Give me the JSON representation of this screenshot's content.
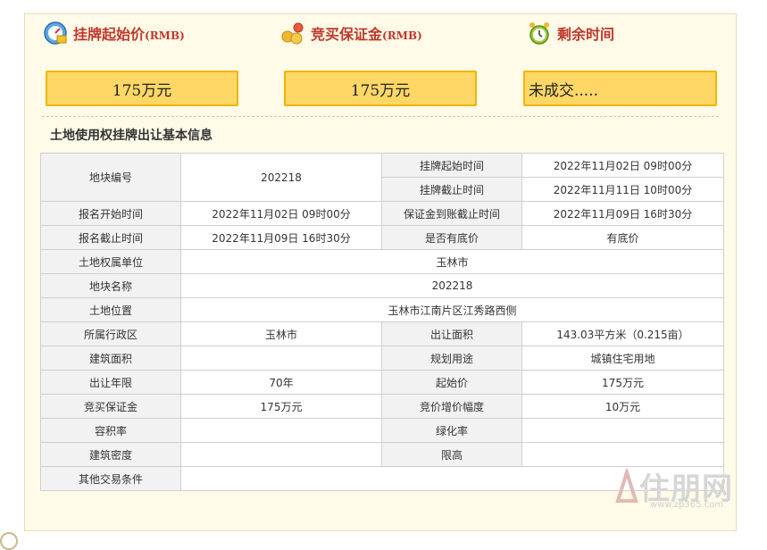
{
  "header": {
    "start_price_label": "挂牌起始价",
    "start_price_unit": "(RMB)",
    "deposit_label": "竞买保证金",
    "deposit_unit": "(RMB)",
    "remaining_label": "剩余时间",
    "start_price_value": "175万元",
    "deposit_value": "175万元",
    "remaining_value": "未成交....."
  },
  "section_title": "土地使用权挂牌出让基本信息",
  "table": {
    "r1": {
      "k1": "地块编号",
      "v1": "202218",
      "k2": "挂牌起始时间",
      "v2": "2022年11月02日 09时00分"
    },
    "r2": {
      "k2": "挂牌截止时间",
      "v2": "2022年11月11日 10时00分"
    },
    "r3": {
      "k1": "报名开始时间",
      "v1": "2022年11月02日 09时00分",
      "k2": "保证金到账截止时间",
      "v2": "2022年11月09日 16时30分"
    },
    "r4": {
      "k1": "报名截止时间",
      "v1": "2022年11月09日 16时30分",
      "k2": "是否有底价",
      "v2": "有底价"
    },
    "r5": {
      "k1": "土地权属单位",
      "v1": "玉林市"
    },
    "r6": {
      "k1": "地块名称",
      "v1": "202218"
    },
    "r7": {
      "k1": "土地位置",
      "v1": "玉林市江南片区江秀路西侧"
    },
    "r8": {
      "k1": "所属行政区",
      "v1": "玉林市",
      "k2": "出让面积",
      "v2": "143.03平方米（0.215亩）"
    },
    "r9": {
      "k1": "建筑面积",
      "v1": "",
      "k2": "规划用途",
      "v2": "城镇住宅用地"
    },
    "r10": {
      "k1": "出让年限",
      "v1": "70年",
      "k2": "起始价",
      "v2": "175万元"
    },
    "r11": {
      "k1": "竞买保证金",
      "v1": "175万元",
      "k2": "竞价增价幅度",
      "v2": "10万元"
    },
    "r12": {
      "k1": "容积率",
      "v1": "",
      "k2": "绿化率",
      "v2": ""
    },
    "r13": {
      "k1": "建筑密度",
      "v1": "",
      "k2": "限高",
      "v2": ""
    },
    "r14": {
      "k1": "其他交易条件",
      "v1": ""
    }
  },
  "watermark": {
    "text": "住朋网",
    "url": "www.zp365.com"
  },
  "icons": {
    "price": "price-dial-icon",
    "deposit": "coins-icon",
    "time": "alarm-clock-icon"
  }
}
